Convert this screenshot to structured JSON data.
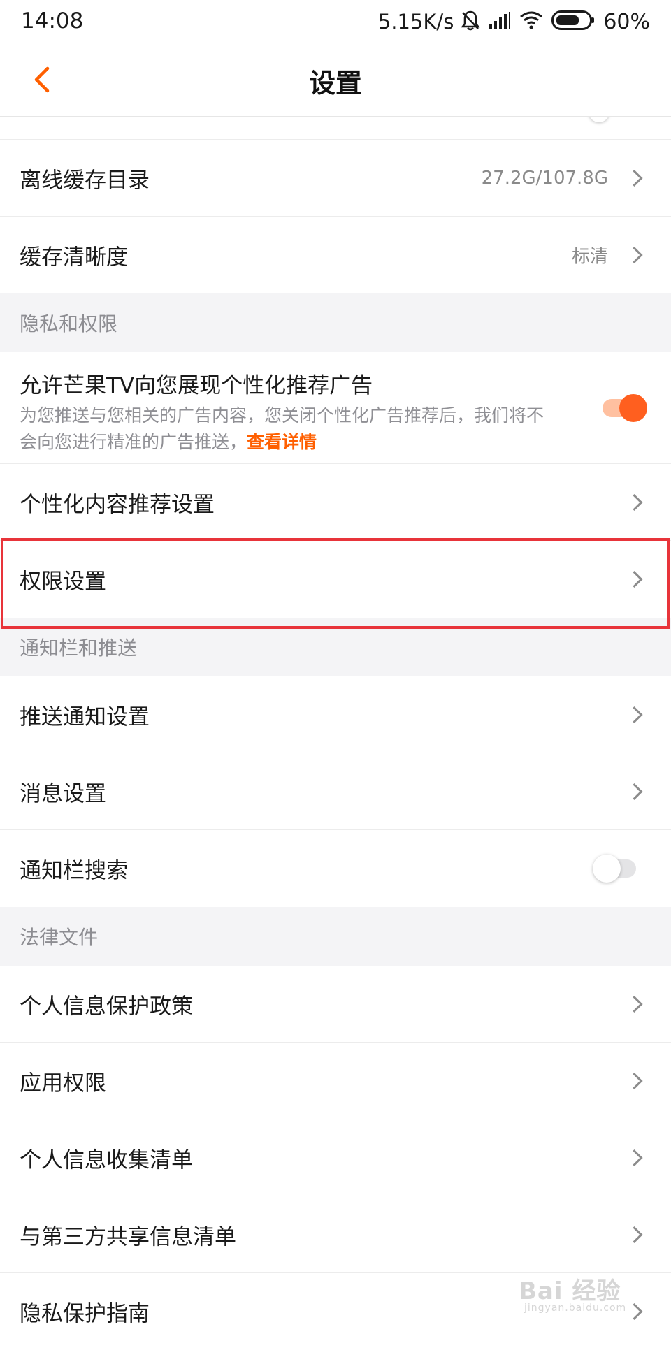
{
  "status_bar": {
    "time": "14:08",
    "network_speed": "5.15K/s",
    "battery": "60%",
    "icons": [
      "mute-bell-icon",
      "signal-icon",
      "wifi-icon",
      "battery-icon"
    ]
  },
  "nav": {
    "title": "设置",
    "back_icon": "chevron-left-icon",
    "accent_color": "#ff5f00"
  },
  "storage": {
    "offline_cache": {
      "label": "离线缓存目录",
      "value": "27.2G/107.8G"
    },
    "cache_quality": {
      "label": "缓存清晰度",
      "value": "标清"
    }
  },
  "privacy": {
    "header": "隐私和权限",
    "personalized_ads": {
      "title": "允许芒果TV向您展现个性化推荐广告",
      "desc": "为您推送与您相关的广告内容，您关闭个性化广告推荐后，我们将不会向您进行精准的广告推送，",
      "link": "查看详情",
      "enabled": true
    },
    "content_recommend": {
      "label": "个性化内容推荐设置"
    },
    "permission_settings": {
      "label": "权限设置",
      "highlighted": true
    }
  },
  "notifications": {
    "header": "通知栏和推送",
    "push_settings": {
      "label": "推送通知设置"
    },
    "message_settings": {
      "label": "消息设置"
    },
    "notification_search": {
      "label": "通知栏搜索",
      "enabled": false
    }
  },
  "legal": {
    "header": "法律文件",
    "items": [
      {
        "label": "个人信息保护政策"
      },
      {
        "label": "应用权限"
      },
      {
        "label": "个人信息收集清单"
      },
      {
        "label": "与第三方共享信息清单"
      },
      {
        "label": "隐私保护指南"
      }
    ]
  },
  "watermark": {
    "main": "Bai 经验",
    "sub": "jingyan.baidu.com"
  }
}
